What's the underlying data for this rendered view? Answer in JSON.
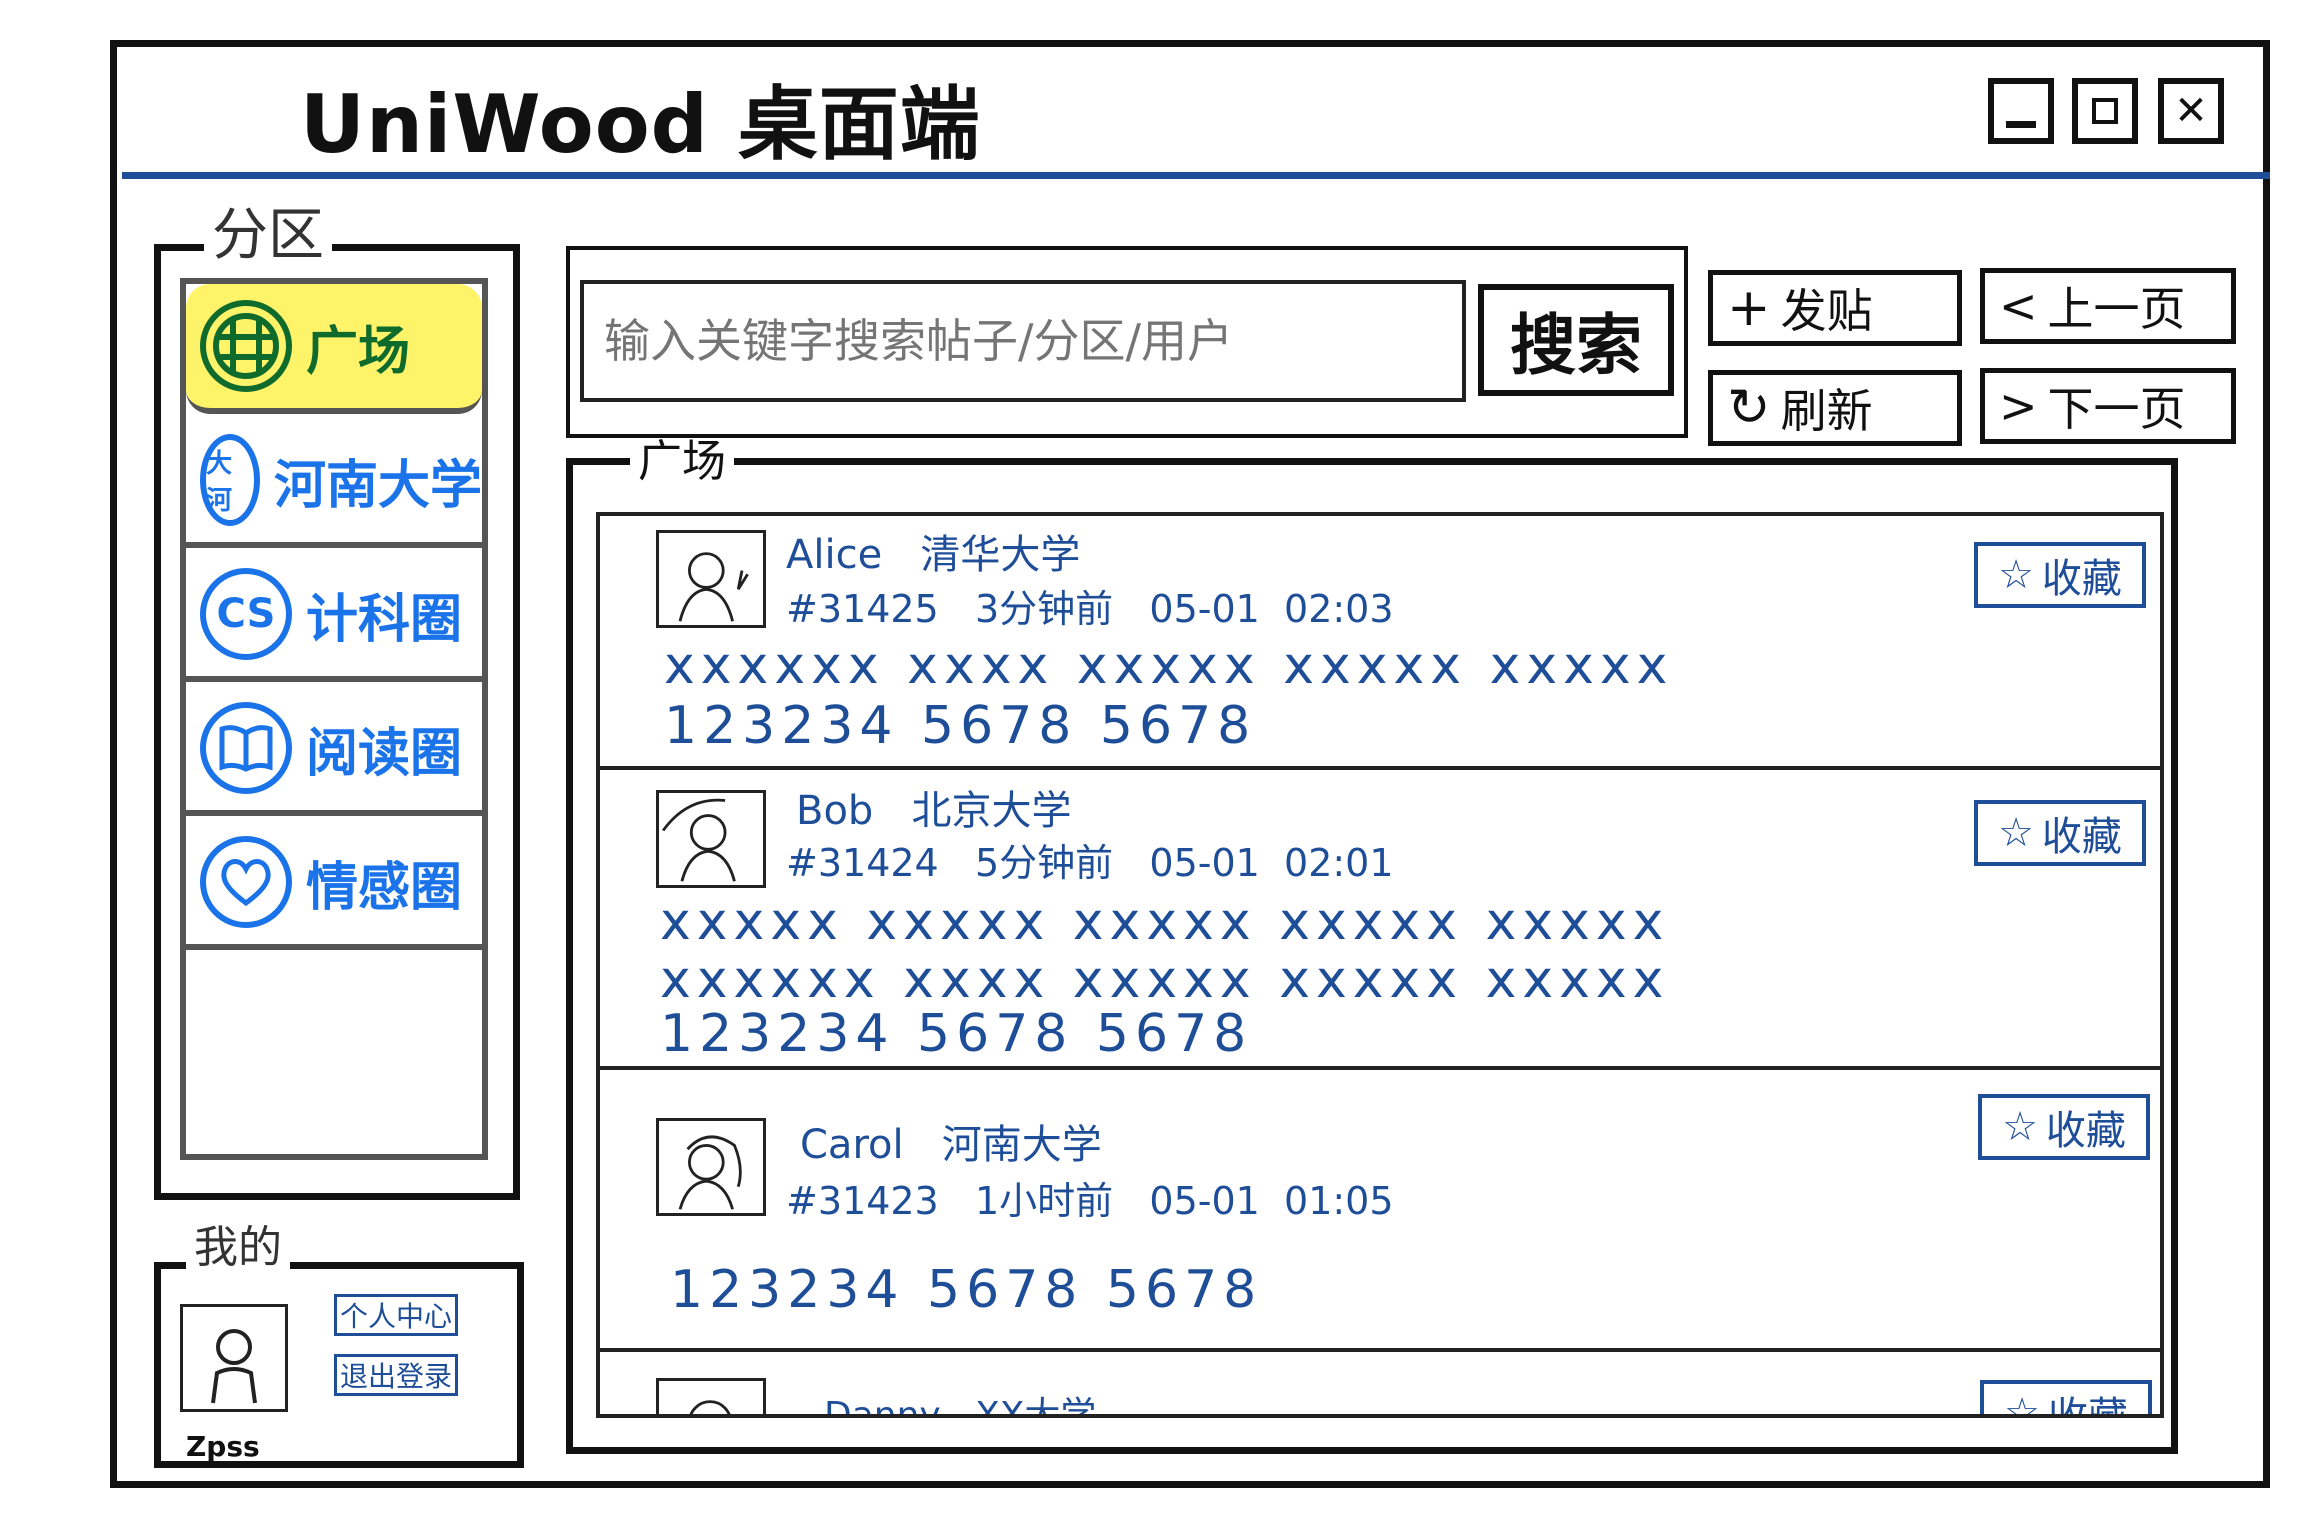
{
  "window": {
    "title": "UniWood 桌面端",
    "controls": {
      "minimize_icon": "minimize-icon",
      "maximize_icon": "maximize-icon",
      "close_glyph": "✕"
    }
  },
  "sidebar": {
    "legend": "分区",
    "items": [
      {
        "label": "广场",
        "icon": "globe-icon",
        "icon_text": "",
        "active": true
      },
      {
        "label": "河南大学",
        "icon": "university-icon",
        "icon_text": "大河"
      },
      {
        "label": "计科圈",
        "icon": "cs-icon",
        "icon_text": "CS"
      },
      {
        "label": "阅读圈",
        "icon": "book-icon",
        "icon_text": ""
      },
      {
        "label": "情感圈",
        "icon": "heart-icon",
        "icon_text": ""
      }
    ]
  },
  "search": {
    "placeholder": "输入关键字搜索帖子/分区/用户",
    "button_label": "搜索"
  },
  "toolbar": {
    "new_post_icon": "+",
    "new_post_label": "发贴",
    "refresh_icon": "↻",
    "refresh_label": "刷新",
    "prev_icon": "<",
    "prev_label": "上一页",
    "next_icon": ">",
    "next_label": "下一页"
  },
  "feed": {
    "legend": "广场",
    "posts": [
      {
        "author": "Alice",
        "school": "清华大学",
        "id": "#31425",
        "ago": "3分钟前",
        "date": "05-01",
        "time": "02:03",
        "lines": [
          "xxxxxx xxxx xxxxx xxxxx xxxxx",
          "123234 5678 5678"
        ]
      },
      {
        "author": "Bob",
        "school": "北京大学",
        "id": "#31424",
        "ago": "5分钟前",
        "date": "05-01",
        "time": "02:01",
        "lines": [
          "xxxxx xxxxx xxxxx xxxxx xxxxx",
          "xxxxxx xxxx xxxxx xxxxx xxxxx",
          "123234 5678 5678"
        ]
      },
      {
        "author": "Carol",
        "school": "河南大学",
        "id": "#31423",
        "ago": "1小时前",
        "date": "05-01",
        "time": "01:05",
        "lines": [
          "123234 5678 5678"
        ]
      },
      {
        "author": "Danny",
        "school": "XX大学",
        "id": "",
        "ago": "",
        "date": "",
        "time": "",
        "lines": []
      }
    ],
    "favorite_icon": "☆",
    "favorite_label": "收藏"
  },
  "mine": {
    "legend": "我的",
    "username": "Zpss",
    "profile_label": "个人中心",
    "logout_label": "退出登录"
  },
  "colors": {
    "accent_blue": "#1f4e99",
    "sidebar_blue": "#1a73e8",
    "active_green": "#0f6b2b",
    "highlight_yellow": "#fff36a"
  }
}
